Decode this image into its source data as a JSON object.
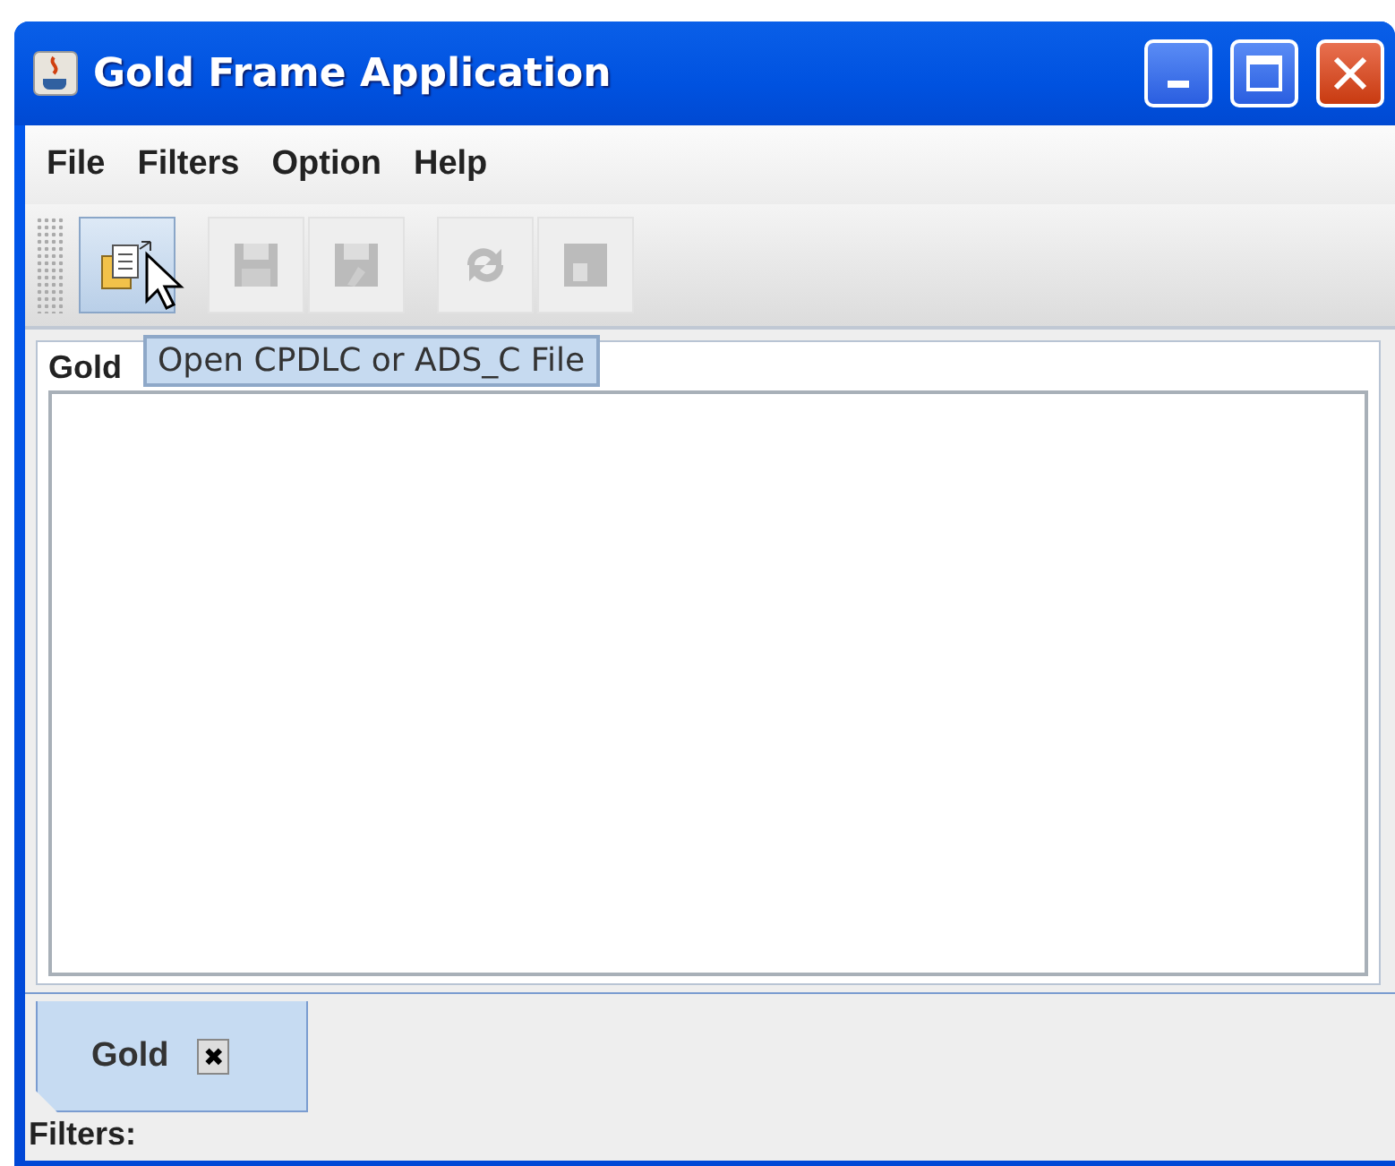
{
  "window": {
    "title": "Gold Frame Application"
  },
  "menu": [
    "File",
    "Filters",
    "Option",
    "Help"
  ],
  "toolbar": [
    {
      "kind": "open",
      "disabled": false
    },
    {
      "kind": "save",
      "disabled": true
    },
    {
      "kind": "save-as",
      "disabled": true
    },
    {
      "kind": "sync",
      "disabled": true
    },
    {
      "kind": "export",
      "disabled": true
    }
  ],
  "tooltip": "Open CPDLC or ADS_C File",
  "panel": {
    "label": "Gold"
  },
  "tabs": [
    {
      "label": "Gold",
      "selected": true,
      "close": "✖"
    }
  ],
  "status_bar": "Filters:"
}
